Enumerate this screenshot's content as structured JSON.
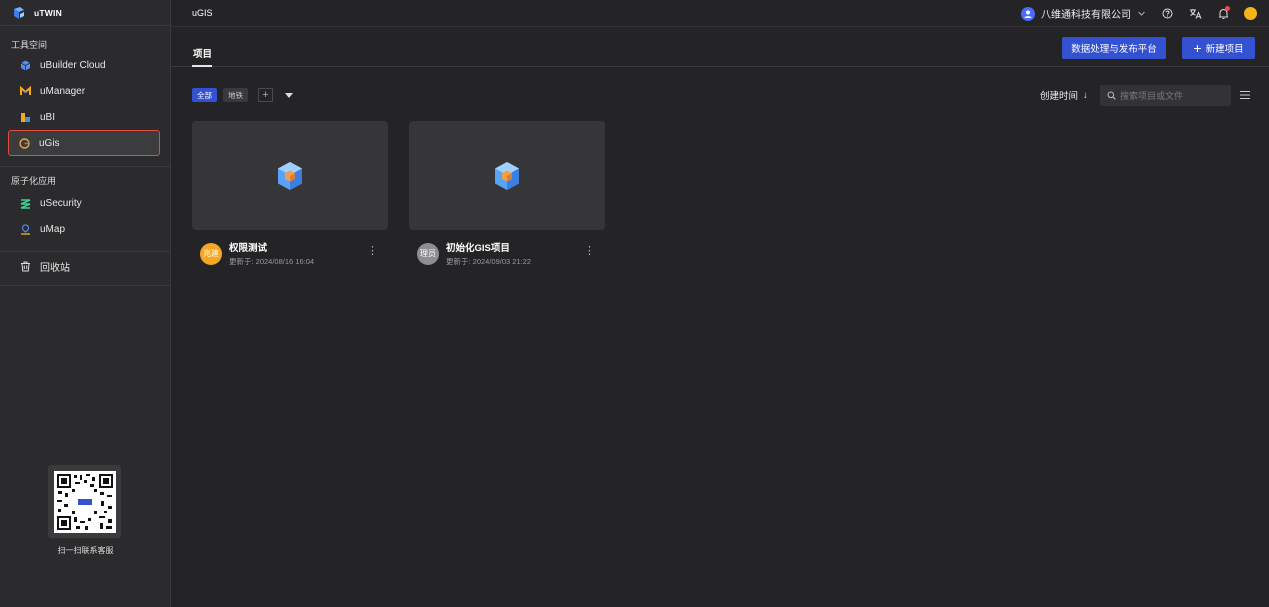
{
  "brand": {
    "name": "uTWIN"
  },
  "sidebar": {
    "workspace_title": "工具空间",
    "workspace_items": [
      {
        "label": "uBuilder Cloud",
        "icon": "ubuilder-icon"
      },
      {
        "label": "uManager",
        "icon": "umanager-icon"
      },
      {
        "label": "uBI",
        "icon": "ubi-icon"
      },
      {
        "label": "uGis",
        "icon": "ugis-icon",
        "active": true
      }
    ],
    "atomic_title": "原子化应用",
    "atomic_items": [
      {
        "label": "uSecurity",
        "icon": "usecurity-icon"
      },
      {
        "label": "uMap",
        "icon": "umap-icon"
      }
    ],
    "recycle_label": "回收站",
    "qr_caption": "扫一扫联系客服"
  },
  "topbar": {
    "title": "uGIS",
    "company": "八维通科技有限公司"
  },
  "tabs": {
    "active_label": "项目"
  },
  "actions": {
    "data_button": "数据处理与发布平台",
    "new_button_plus": "+",
    "new_button": "新建项目"
  },
  "filters": {
    "chips": [
      "全部",
      "地铁"
    ],
    "add": "+"
  },
  "sort": {
    "label": "创建时间",
    "arrow": "↓"
  },
  "search": {
    "placeholder": "搜索项目或文件"
  },
  "projects": [
    {
      "avatar_text": "兆建",
      "avatar_color": "#f5a623",
      "title": "权限测试",
      "updated": "更新于: 2024/08/16 16:04"
    },
    {
      "avatar_text": "理员",
      "avatar_color": "#8e8e90",
      "title": "初始化GIS项目",
      "updated": "更新于: 2024/09/03 21:22"
    }
  ],
  "colors": {
    "accent": "#3451d1",
    "active_border": "#e24a3b",
    "background": "#242426"
  }
}
